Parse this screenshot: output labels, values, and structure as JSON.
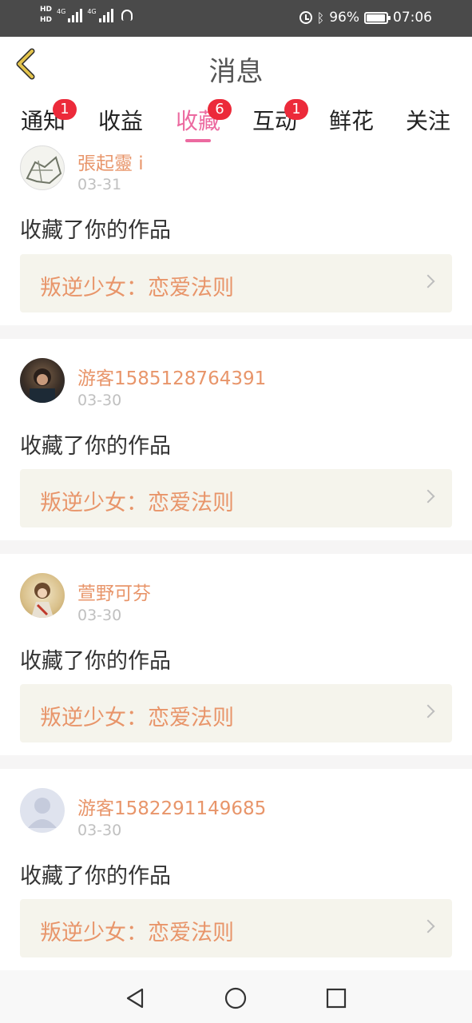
{
  "status_bar": {
    "hd_top": "HD",
    "hd_bottom": "HD",
    "sim1": "4G",
    "sim2": "4G",
    "battery_percent": "96%",
    "time": "07:06",
    "icons": [
      "signal-icon",
      "headphone-icon",
      "alarm-icon",
      "bluetooth-icon",
      "battery-icon"
    ]
  },
  "header": {
    "title": "消息",
    "back_icon": "chevron-left-icon",
    "back_color": "#e4c44c"
  },
  "tabs": [
    {
      "label": "通知",
      "badge": "1"
    },
    {
      "label": "收益",
      "badge": ""
    },
    {
      "label": "收藏",
      "badge": "6",
      "active": true
    },
    {
      "label": "互动",
      "badge": "1"
    },
    {
      "label": "鲜花",
      "badge": ""
    },
    {
      "label": "关注",
      "badge": ""
    }
  ],
  "colors": {
    "accent": "#ec6aa0",
    "badge": "#ec2a3a",
    "username": "#e8956a",
    "work_box": "#f5f4ec"
  },
  "feed": [
    {
      "username": "張起靈 i",
      "date": "03-31",
      "action": "收藏了你的作品",
      "work": "叛逆少女：恋爱法则",
      "avatar": "avatar-sketch"
    },
    {
      "username": "游客1585128764391",
      "date": "03-30",
      "action": "收藏了你的作品",
      "work": "叛逆少女：恋爱法则",
      "avatar": "avatar-photo-dark"
    },
    {
      "username": "萱野可芬",
      "date": "03-30",
      "action": "收藏了你的作品",
      "work": "叛逆少女：恋爱法则",
      "avatar": "avatar-photo-light"
    },
    {
      "username": "游客1582291149685",
      "date": "03-30",
      "action": "收藏了你的作品",
      "work": "叛逆少女：恋爱法则",
      "avatar": "avatar-default"
    }
  ],
  "navigation": {
    "icons": [
      "back-triangle-icon",
      "home-circle-icon",
      "recents-square-icon"
    ]
  }
}
